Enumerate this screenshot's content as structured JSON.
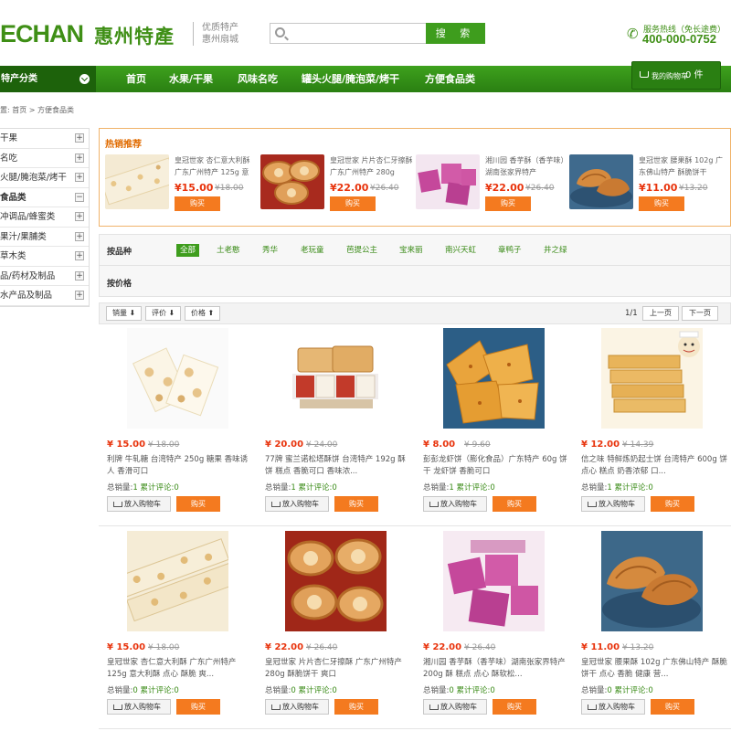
{
  "header": {
    "logo_en": "ECHAN",
    "logo_cn": "惠州特產",
    "logo_sub1": "优质特产",
    "logo_sub2": "惠州扇城",
    "search_placeholder": "",
    "search_button": "搜 索",
    "hotline_label": "服务热线（免长途费）",
    "hotline_number": "400-000-0752"
  },
  "nav": {
    "category_label": "特产分类",
    "items": [
      "首页",
      "水果/干果",
      "风味名吃",
      "罐头火腿/腌泡菜/烤干",
      "方便食品类"
    ],
    "cart_label": "我的购物车",
    "cart_count": "0 件"
  },
  "breadcrumb": "置: 首页 > 方便食品类",
  "sidebar": [
    {
      "label": "干果",
      "sign": "+"
    },
    {
      "label": "名吃",
      "sign": "+"
    },
    {
      "label": "火腿/腌泡菜/烤干",
      "sign": "+"
    },
    {
      "label": "食品类",
      "sign": "−"
    },
    {
      "label": "冲调品/蜂蜜类",
      "sign": "+"
    },
    {
      "label": "果汁/果脯类",
      "sign": "+"
    },
    {
      "label": "草木类",
      "sign": "+"
    },
    {
      "label": "品/药材及制品",
      "sign": "+"
    },
    {
      "label": "水产品及制品",
      "sign": "+"
    }
  ],
  "hot": {
    "title": "热销推荐",
    "items": [
      {
        "name": "皇冠世家 杏仁意大利酥 广东广州特产 125g 意",
        "price": "¥15.00",
        "old": "¥18.00",
        "buy": "购买"
      },
      {
        "name": "皇冠世家 片片杏仁牙擦酥 广东广州特产 280g",
        "price": "¥22.00",
        "old": "¥26.40",
        "buy": "购买"
      },
      {
        "name": "湘川园 香芋酥（香芋味）湖南张家界特产",
        "price": "¥22.00",
        "old": "¥26.40",
        "buy": "购买"
      },
      {
        "name": "皇冠世家 腰果酥 102g 广东佛山特产 酥脆饼干",
        "price": "¥11.00",
        "old": "¥13.20",
        "buy": "购买"
      }
    ]
  },
  "filter": {
    "brand_label": "按品种",
    "price_label": "按价格",
    "brands": [
      "全部",
      "土老憨",
      "秀华",
      "老玩童",
      "芭提公主",
      "宝来丽",
      "南兴天虹",
      "章鸭子",
      "井之绿"
    ]
  },
  "sortbar": {
    "sort_sales": "销量",
    "sort_review": "评价",
    "sort_price": "价格",
    "page_info": "1/1",
    "prev": "上一页",
    "next": "下一页"
  },
  "products": [
    {
      "price": "¥ 15.00",
      "old": "¥ 18.00",
      "name": "利牌 牛轧糖 台湾特产 250g 糖果 香味诱人 香滑可口",
      "sales_label": "总销量:",
      "sales": "1",
      "reviews_label": "累计评论:",
      "reviews": "0",
      "add": "放入购物车",
      "buy": "购买"
    },
    {
      "price": "¥ 20.00",
      "old": "¥ 24.00",
      "name": "77牌 蜜兰诺松塔酥饼 台湾特产 192g 酥饼 糕点 香脆可口 香味浓...",
      "sales_label": "总销量:",
      "sales": "1",
      "reviews_label": "累计评论:",
      "reviews": "0",
      "add": "放入购物车",
      "buy": "购买"
    },
    {
      "price": "¥ 8.00",
      "old": "¥ 9.60",
      "name": "彭彭龙虾饼（膨化食品）广东特产 60g 饼干 龙虾饼 香脆可口",
      "sales_label": "总销量:",
      "sales": "1",
      "reviews_label": "累计评论:",
      "reviews": "0",
      "add": "放入购物车",
      "buy": "购买"
    },
    {
      "price": "¥ 12.00",
      "old": "¥ 14.39",
      "name": "信之味 特鲜炼奶起士饼 台湾特产 600g 饼 点心 糕点 奶香浓郁 口...",
      "sales_label": "总销量:",
      "sales": "1",
      "reviews_label": "累计评论:",
      "reviews": "0",
      "add": "放入购物车",
      "buy": "购买"
    },
    {
      "price": "¥ 15.00",
      "old": "¥ 18.00",
      "name": "皇冠世家 杏仁意大利酥 广东广州特产 125g 意大利酥 点心 酥脆 爽...",
      "sales_label": "总销量:",
      "sales": "0",
      "reviews_label": "累计评论:",
      "reviews": "0",
      "add": "放入购物车",
      "buy": "购买"
    },
    {
      "price": "¥ 22.00",
      "old": "¥ 26.40",
      "name": "皇冠世家 片片杏仁牙擦酥 广东广州特产 280g 酥脆饼干 爽口",
      "sales_label": "总销量:",
      "sales": "0",
      "reviews_label": "累计评论:",
      "reviews": "0",
      "add": "放入购物车",
      "buy": "购买"
    },
    {
      "price": "¥ 22.00",
      "old": "¥ 26.40",
      "name": "湘川园 香芋酥（香芋味）湖南张家界特产 200g 酥 糕点 点心 酥软松...",
      "sales_label": "总销量:",
      "sales": "0",
      "reviews_label": "累计评论:",
      "reviews": "0",
      "add": "放入购物车",
      "buy": "购买"
    },
    {
      "price": "¥ 11.00",
      "old": "¥ 13.20",
      "name": "皇冠世家 腰果酥 102g 广东佛山特产 酥脆饼干 点心 香脆 健康 营...",
      "sales_label": "总销量:",
      "sales": "0",
      "reviews_label": "累计评论:",
      "reviews": "0",
      "add": "放入购物车",
      "buy": "购买"
    }
  ]
}
